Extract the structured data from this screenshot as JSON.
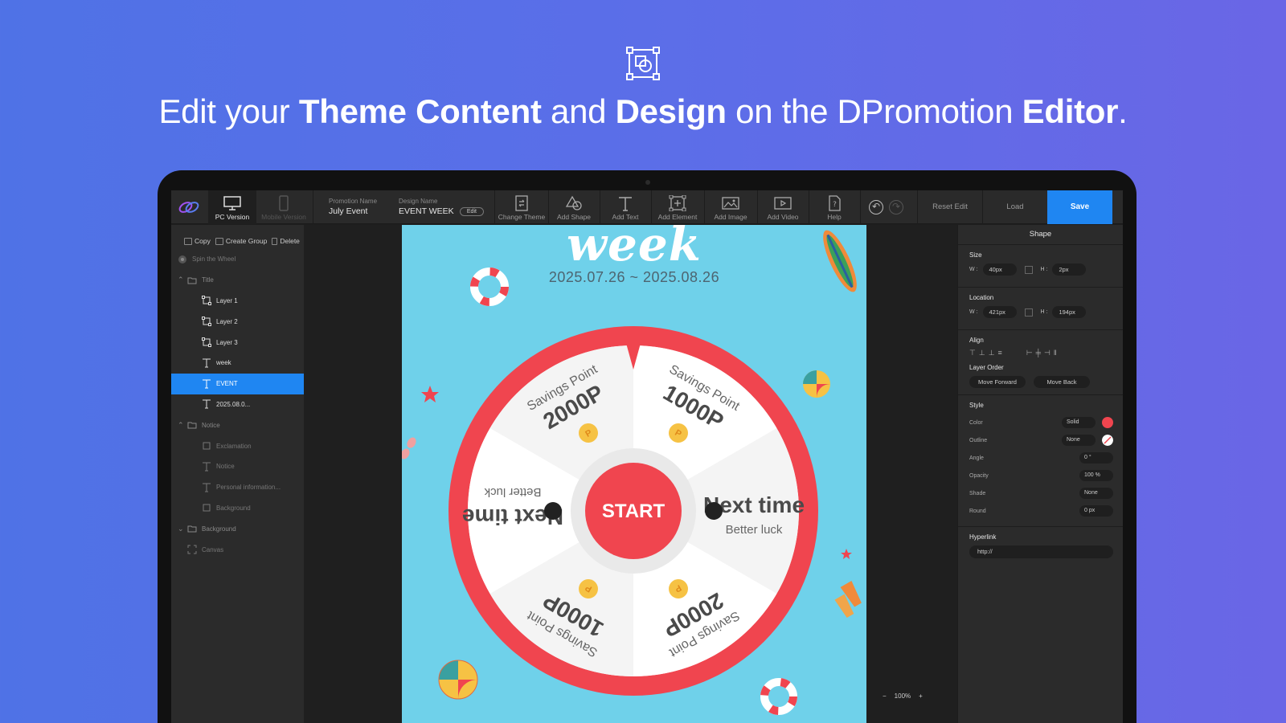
{
  "hero": {
    "icon": "element-box-icon",
    "headline_parts": [
      "Edit your ",
      "Theme Content",
      " and ",
      "Design",
      " on the DPromotion ",
      "Editor",
      "."
    ]
  },
  "toolbar": {
    "pc_version": "PC Version",
    "mobile_version": "Mobile Version",
    "promotion_name_label": "Promotion Name",
    "promotion_name_value": "July Event",
    "design_name_label": "Design Name",
    "design_name_value": "EVENT WEEK",
    "edit_label": "Edit",
    "tools": [
      "Change Theme",
      "Add Shape",
      "Add Text",
      "Add Element",
      "Add Image",
      "Add Video",
      "Help"
    ],
    "reset_label": "Reset Edit",
    "load_label": "Load",
    "save_label": "Save",
    "accent": "#1f86f2"
  },
  "layers": {
    "copy": "Copy",
    "create_group": "Create Group",
    "delete": "Delete",
    "root": "Spin the Wheel",
    "title_group": "Title",
    "title_items": [
      "Layer 1",
      "Layer 2",
      "Layer 3",
      "week",
      "EVENT",
      "2025.08.0..."
    ],
    "notice_group": "Notice",
    "notice_items": [
      "Exclamation",
      "Notice",
      "Personal information...",
      "Background"
    ],
    "background_group": "Background",
    "background_items": [
      "Canvas"
    ]
  },
  "design": {
    "heading": "week",
    "dates": "2025.07.26 ~ 2025.08.26",
    "start": "START",
    "wheel_color": "#f0454f",
    "segments": [
      {
        "top": "Savings Point",
        "main": "1000P"
      },
      {
        "top": "Better luck",
        "main": "Next time"
      },
      {
        "top": "Savings Point",
        "main": "2000P"
      },
      {
        "top": "Savings Point",
        "main": "1000P"
      },
      {
        "top": "Better luck",
        "main": "Next time"
      },
      {
        "top": "Savings Point",
        "main": "2000P"
      }
    ],
    "zoom": "100%"
  },
  "properties": {
    "title": "Shape",
    "size_label": "Size",
    "size_w": "40px",
    "size_h": "2px",
    "location_label": "Location",
    "loc_w": "421px",
    "loc_h": "194px",
    "w_label": "W :",
    "h_label": "H :",
    "align_label": "Align",
    "layer_order_label": "Layer Order",
    "move_forward": "Move Forward",
    "move_back": "Move Back",
    "style_label": "Style",
    "color_label": "Color",
    "color_mode": "Solid",
    "color_value": "#f0454f",
    "outline_label": "Outline",
    "outline_value": "None",
    "angle_label": "Angle",
    "angle_value": "0 °",
    "opacity_label": "Opacity",
    "opacity_value": "100 %",
    "shade_label": "Shade",
    "shade_value": "None",
    "round_label": "Round",
    "round_value": "0 px",
    "hyperlink_label": "Hyperlink",
    "hyperlink_value": "http://"
  }
}
